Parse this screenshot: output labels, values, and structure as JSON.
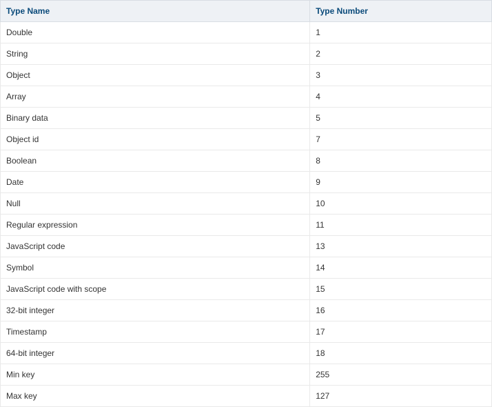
{
  "table": {
    "headers": {
      "name": "Type Name",
      "number": "Type Number"
    },
    "rows": [
      {
        "name": "Double",
        "number": "1"
      },
      {
        "name": "String",
        "number": "2"
      },
      {
        "name": "Object",
        "number": "3"
      },
      {
        "name": "Array",
        "number": "4"
      },
      {
        "name": "Binary data",
        "number": "5"
      },
      {
        "name": "Object id",
        "number": "7"
      },
      {
        "name": "Boolean",
        "number": "8"
      },
      {
        "name": "Date",
        "number": "9"
      },
      {
        "name": "Null",
        "number": "10"
      },
      {
        "name": "Regular expression",
        "number": "11"
      },
      {
        "name": "JavaScript code",
        "number": "13"
      },
      {
        "name": "Symbol",
        "number": "14"
      },
      {
        "name": "JavaScript code with scope",
        "number": "15"
      },
      {
        "name": "32-bit integer",
        "number": "16"
      },
      {
        "name": "Timestamp",
        "number": "17"
      },
      {
        "name": "64-bit integer",
        "number": "18"
      },
      {
        "name": "Min key",
        "number": "255"
      },
      {
        "name": "Max key",
        "number": "127"
      }
    ]
  }
}
